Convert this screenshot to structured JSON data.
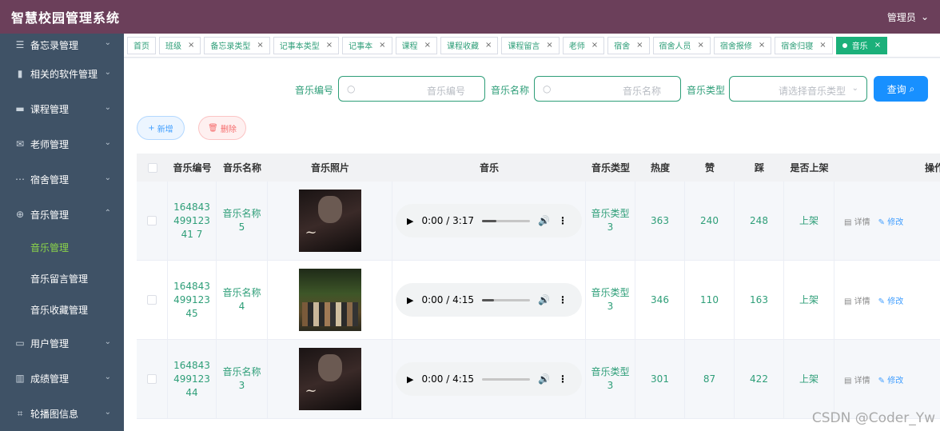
{
  "header": {
    "title": "智慧校园管理系统",
    "user": "管理员"
  },
  "sidebar": {
    "items": [
      {
        "label": "备忘录管理",
        "icon": "list-icon"
      },
      {
        "label": "相关的软件管理",
        "icon": "bar-chart-icon"
      },
      {
        "label": "课程管理",
        "icon": "folder-icon"
      },
      {
        "label": "老师管理",
        "icon": "mail-icon"
      },
      {
        "label": "宿舍管理",
        "icon": "chat-icon"
      },
      {
        "label": "音乐管理",
        "icon": "compass-icon",
        "expanded": true,
        "children": [
          {
            "label": "音乐管理",
            "active": true
          },
          {
            "label": "音乐留言管理"
          },
          {
            "label": "音乐收藏管理"
          }
        ]
      },
      {
        "label": "用户管理",
        "icon": "card-icon"
      },
      {
        "label": "成绩管理",
        "icon": "chart-icon"
      },
      {
        "label": "轮播图信息",
        "icon": "crop-icon"
      }
    ]
  },
  "tabs": [
    {
      "label": "首页",
      "closable": false
    },
    {
      "label": "班级",
      "closable": true
    },
    {
      "label": "备忘录类型",
      "closable": true
    },
    {
      "label": "记事本类型",
      "closable": true
    },
    {
      "label": "记事本",
      "closable": true
    },
    {
      "label": "课程",
      "closable": true
    },
    {
      "label": "课程收藏",
      "closable": true
    },
    {
      "label": "课程留言",
      "closable": true
    },
    {
      "label": "老师",
      "closable": true
    },
    {
      "label": "宿舍",
      "closable": true
    },
    {
      "label": "宿舍人员",
      "closable": true
    },
    {
      "label": "宿舍报修",
      "closable": true
    },
    {
      "label": "宿舍归寝",
      "closable": true
    },
    {
      "label": "音乐",
      "closable": true,
      "active": true
    }
  ],
  "search": {
    "code_label": "音乐编号",
    "code_placeholder": "音乐编号",
    "name_label": "音乐名称",
    "name_placeholder": "音乐名称",
    "type_label": "音乐类型",
    "type_placeholder": "请选择音乐类型",
    "query_button": "查询"
  },
  "actions": {
    "add": "新增",
    "delete": "删除"
  },
  "table": {
    "columns": [
      "音乐编号",
      "音乐名称",
      "音乐照片",
      "音乐",
      "音乐类型",
      "热度",
      "赞",
      "踩",
      "是否上架",
      "操作"
    ],
    "rows": [
      {
        "code": "16484349912341 7",
        "name": "音乐名称5",
        "cover": "a",
        "time": "0:00 / 3:17",
        "progress": 0.3,
        "type": "音乐类型3",
        "hot": "363",
        "like": "240",
        "dislike": "248",
        "shelf": "上架"
      },
      {
        "code": "16484349912345",
        "name": "音乐名称4",
        "cover": "b",
        "time": "0:00 / 4:15",
        "progress": 0.25,
        "type": "音乐类型3",
        "hot": "346",
        "like": "110",
        "dislike": "163",
        "shelf": "上架"
      },
      {
        "code": "16484349912344",
        "name": "音乐名称3",
        "cover": "a",
        "time": "0:00 / 4:15",
        "progress": 0.0,
        "type": "音乐类型3",
        "hot": "301",
        "like": "87",
        "dislike": "422",
        "shelf": "上架"
      }
    ],
    "op_detail": "详情",
    "op_edit": "修改"
  },
  "watermark": "CSDN @Coder_Yw"
}
